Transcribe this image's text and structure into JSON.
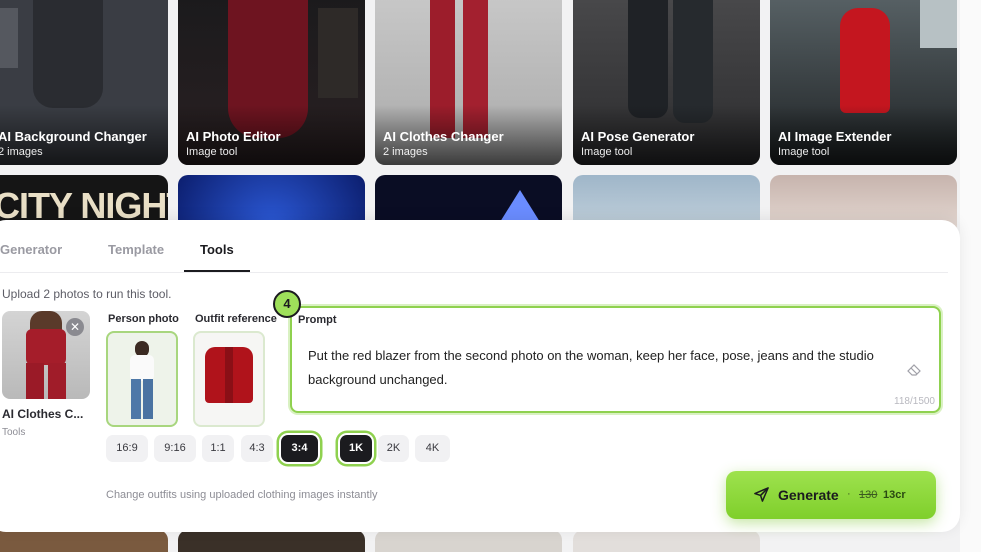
{
  "gallery": {
    "top_cards": [
      {
        "title": "AI Background Changer",
        "subtitle": "2 images"
      },
      {
        "title": "AI Photo Editor",
        "subtitle": "Image tool"
      },
      {
        "title": "AI Clothes Changer",
        "subtitle": "2 images"
      },
      {
        "title": "AI Pose Generator",
        "subtitle": "Image tool"
      },
      {
        "title": "AI Image Extender",
        "subtitle": "Image tool"
      }
    ],
    "poster_text": "CITY NIGHTS"
  },
  "tabs": [
    {
      "label": "Generator"
    },
    {
      "label": "Template"
    },
    {
      "label": "Tools"
    }
  ],
  "tools": {
    "instruction": "Upload 2 photos to run this tool.",
    "selected_tool": {
      "name": "AI Clothes C...",
      "category": "Tools"
    },
    "person_photo_label": "Person photo",
    "outfit_reference_label": "Outfit reference",
    "prompt": {
      "label": "Prompt",
      "text": "Put the red blazer from the second photo on the woman, keep her face, pose, jeans and the studio background unchanged.",
      "counter": "118/1500"
    },
    "step_badge": "4",
    "aspect_ratios": [
      "16:9",
      "9:16",
      "1:1",
      "4:3",
      "3:4"
    ],
    "selected_aspect_ratio": "3:4",
    "resolutions": [
      "1K",
      "2K",
      "4K"
    ],
    "selected_resolution": "1K",
    "description": "Change outfits using uploaded clothing images instantly"
  },
  "generate": {
    "label": "Generate",
    "separator": "·",
    "old_cost": "130",
    "new_cost": "13cr"
  },
  "colors": {
    "accent": "#8fd14f",
    "dark": "#1b1b1f",
    "blazer": "#b0131b"
  }
}
